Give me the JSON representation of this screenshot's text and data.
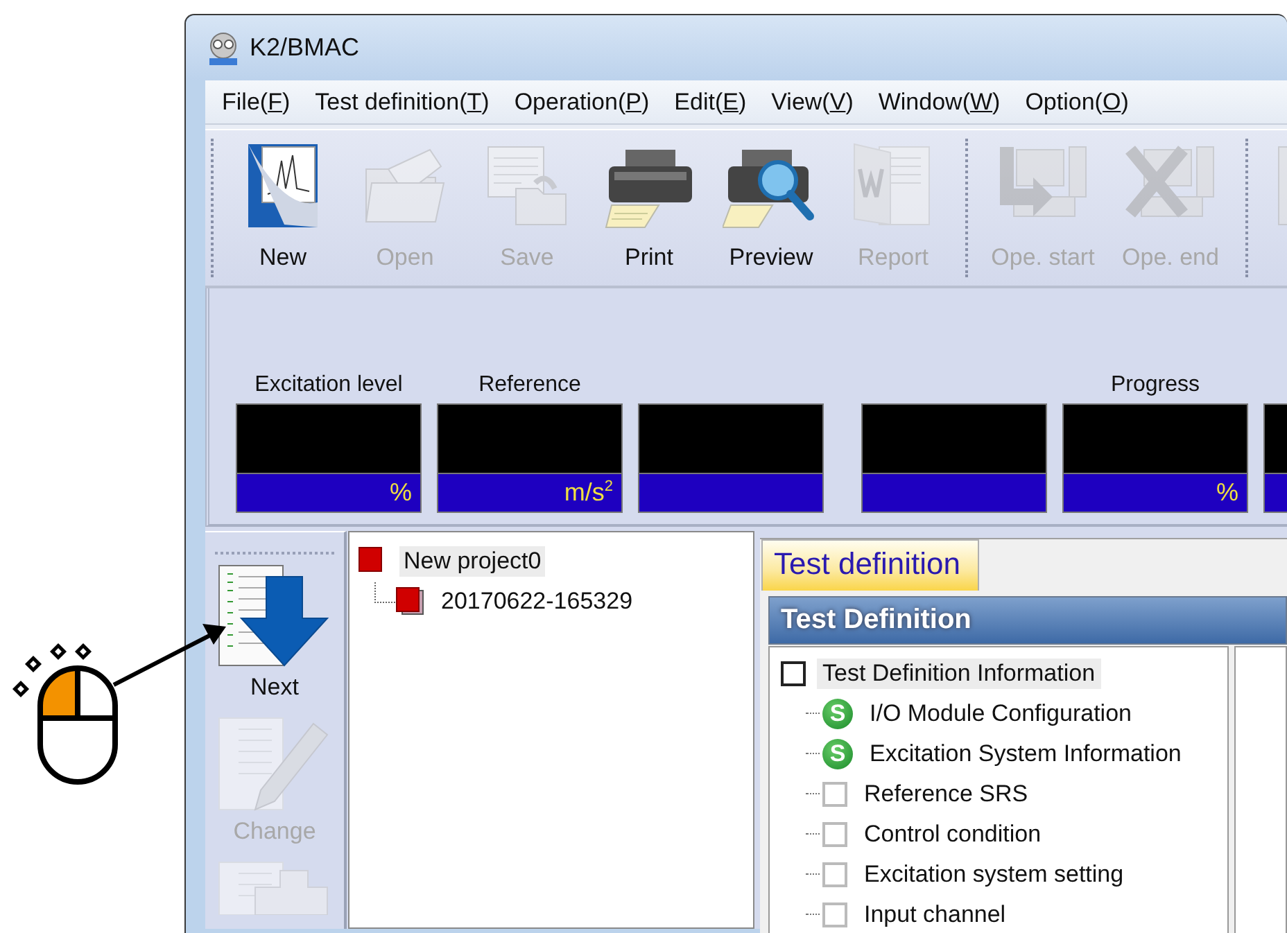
{
  "window": {
    "title": "K2/BMAC"
  },
  "menu": [
    {
      "before": "File(",
      "key": "F",
      "after": ")"
    },
    {
      "before": "Test definition(",
      "key": "T",
      "after": ")"
    },
    {
      "before": "Operation(",
      "key": "P",
      "after": ")"
    },
    {
      "before": "Edit(",
      "key": "E",
      "after": ")"
    },
    {
      "before": "View(",
      "key": "V",
      "after": ")"
    },
    {
      "before": "Window(",
      "key": "W",
      "after": ")"
    },
    {
      "before": "Option(",
      "key": "O",
      "after": ")"
    }
  ],
  "toolbar_groups": [
    [
      {
        "label": "New",
        "kind": "new",
        "disabled": false
      },
      {
        "label": "Open",
        "kind": "open",
        "disabled": true
      },
      {
        "label": "Save",
        "kind": "save",
        "disabled": true
      },
      {
        "label": "Print",
        "kind": "print",
        "disabled": false
      },
      {
        "label": "Preview",
        "kind": "preview",
        "disabled": false
      },
      {
        "label": "Report",
        "kind": "report",
        "disabled": true
      }
    ],
    [
      {
        "label": "Ope. start",
        "kind": "ope-start",
        "disabled": true
      },
      {
        "label": "Ope. end",
        "kind": "ope-end",
        "disabled": true
      }
    ],
    [
      {
        "kind": "blank",
        "disabled": true
      }
    ]
  ],
  "meter_groups": [
    [
      {
        "kind": "meter",
        "label": "Excitation level",
        "unit": "%"
      },
      {
        "kind": "meter",
        "label": "Reference",
        "unit": "m/s$^{2}$"
      },
      {
        "kind": "meter"
      }
    ],
    [
      {
        "kind": "meter"
      },
      {
        "kind": "meter",
        "label": "Progress",
        "unit": "%"
      },
      {
        "kind": "meter"
      }
    ]
  ],
  "side_tools": [
    {
      "label": "Next",
      "kind": "next",
      "disabled": false
    },
    {
      "label": "Change",
      "kind": "change",
      "disabled": true
    },
    {
      "kind": "copy",
      "disabled": true
    }
  ],
  "project_tree": [
    {
      "label": "New project0",
      "selected": true,
      "children": [
        {
          "label": "20170622-165329",
          "selected": false
        }
      ]
    }
  ],
  "tabs": [
    {
      "label": "Test definition",
      "selected": true
    }
  ],
  "panel": {
    "title": "Test Definition",
    "items": [
      {
        "label": "Test Definition Information",
        "kind": "checkbox",
        "checked": false,
        "selected": true,
        "children": [
          {
            "label": "I/O Module Configuration",
            "kind": "status",
            "badge": "S",
            "selected": false
          },
          {
            "label": "Excitation System Information",
            "kind": "status",
            "badge": "S",
            "selected": false
          },
          {
            "label": "Reference SRS",
            "kind": "checkbox",
            "checked": false,
            "selected": false
          },
          {
            "label": "Control condition",
            "kind": "checkbox",
            "checked": false,
            "selected": false
          },
          {
            "label": "Excitation system setting",
            "kind": "checkbox",
            "checked": false,
            "selected": false
          },
          {
            "label": "Input channel",
            "kind": "checkbox",
            "checked": false,
            "selected": false
          }
        ]
      }
    ]
  }
}
